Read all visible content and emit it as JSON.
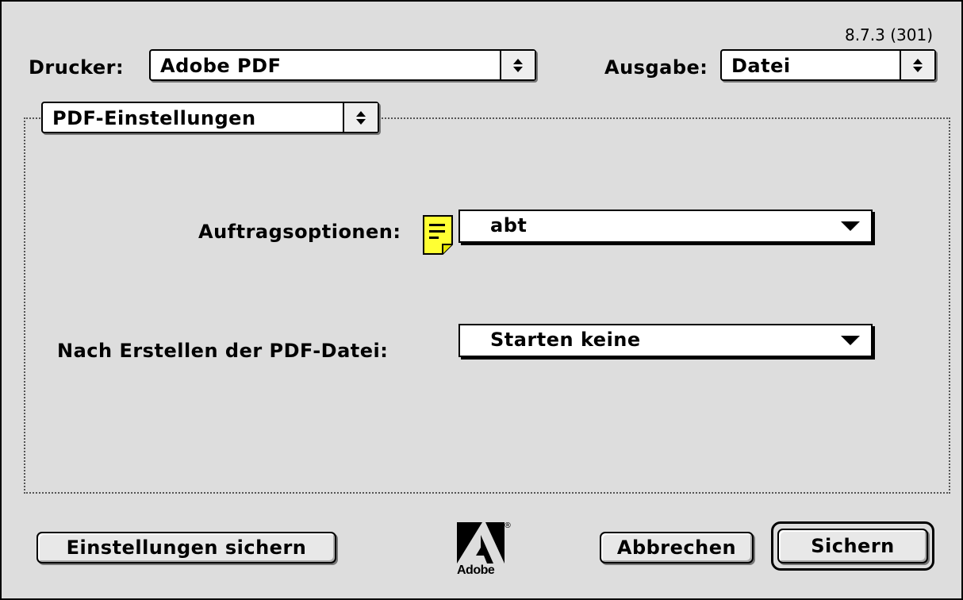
{
  "version": "8.7.3 (301)",
  "printer": {
    "label": "Drucker:",
    "value": "Adobe PDF"
  },
  "output": {
    "label": "Ausgabe:",
    "value": "Datei"
  },
  "panel": {
    "value": "PDF-Einstellungen"
  },
  "job_options": {
    "label": "Auftragsoptionen:",
    "value": "abt"
  },
  "after_create": {
    "label": "Nach Erstellen der PDF-Datei:",
    "value": "Starten keine"
  },
  "buttons": {
    "save_settings": "Einstellungen sichern",
    "cancel": "Abbrechen",
    "save": "Sichern"
  },
  "logo": {
    "text": "Adobe",
    "reg": "®"
  },
  "colors": {
    "dialog_bg": "#dddddd",
    "note_yellow": "#ffff33"
  }
}
